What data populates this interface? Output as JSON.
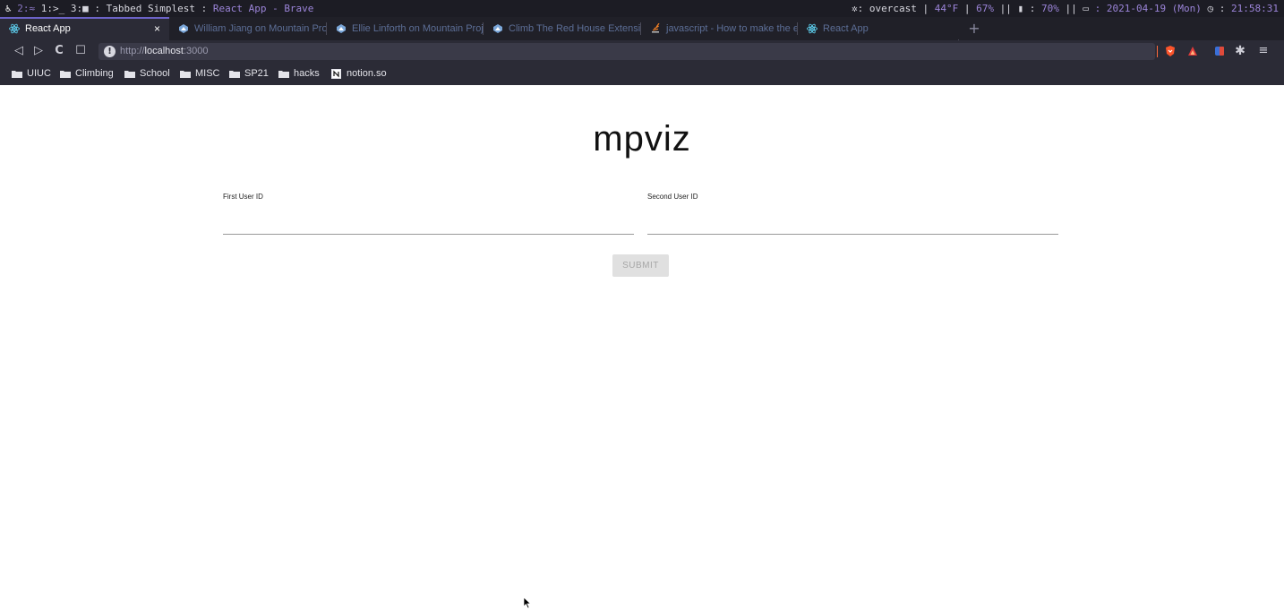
{
  "statusbar": {
    "ws_logo": "♿",
    "ws2": "2:",
    "ws1": "1:>_",
    "ws3": "3:",
    "layout": ": Tabbed Simplest :",
    "window_title": "React App - Brave",
    "weather_label": ": overcast",
    "temp": "44°F",
    "humidity": "67%",
    "battery_label": ":",
    "battery": "70%",
    "date_label": ": 2021-04-19",
    "date_day": "(Mon)",
    "time_label": ":",
    "time": "21:58:31"
  },
  "tabs": [
    {
      "label": "React App",
      "active": true,
      "icon": "react-icon"
    },
    {
      "label": "William Jiang on Mountain Proje",
      "active": false,
      "icon": "mountain-project-icon"
    },
    {
      "label": "Ellie Linforth on Mountain Projec",
      "active": false,
      "icon": "mountain-project-icon"
    },
    {
      "label": "Climb The Red House Extension",
      "active": false,
      "icon": "mountain-project-icon"
    },
    {
      "label": "javascript - How to make the e",
      "active": false,
      "icon": "stackoverflow-icon"
    },
    {
      "label": "React App",
      "active": false,
      "icon": "react-icon"
    }
  ],
  "tab_close": "×",
  "new_tab": "+",
  "toolbar": {
    "back": "◁",
    "forward": "▷",
    "reload": "C",
    "bookmark": "☐",
    "url_scheme": "http://",
    "url_host": "localhost",
    "url_rest": ":3000",
    "menu": "≡"
  },
  "bookmarks": [
    {
      "label": "UIUC",
      "icon": "folder-icon"
    },
    {
      "label": "Climbing",
      "icon": "folder-icon"
    },
    {
      "label": "School",
      "icon": "folder-icon"
    },
    {
      "label": "MISC",
      "icon": "folder-icon"
    },
    {
      "label": "SP21",
      "icon": "folder-icon"
    },
    {
      "label": "hacks",
      "icon": "folder-icon"
    },
    {
      "label": "notion.so",
      "icon": "notion-icon"
    }
  ],
  "page": {
    "title": "mpviz",
    "first_label": "First User ID",
    "first_value": "",
    "second_label": "Second User ID",
    "second_value": "",
    "submit_label": "SUBMIT"
  },
  "colors": {
    "accent": "#6c63c7",
    "chrome_bg": "#2b2b36",
    "status_bg": "#1c1c24"
  }
}
